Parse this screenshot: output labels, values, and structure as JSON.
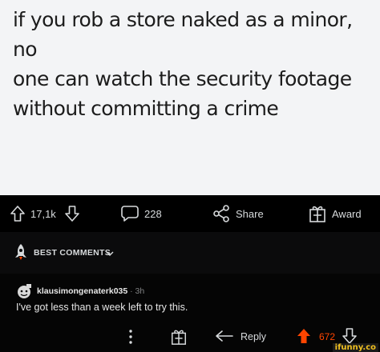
{
  "meme": {
    "lines": [
      "if you rob a store naked as a minor, no",
      "one can watch the security footage",
      "without committing a crime"
    ]
  },
  "actions": {
    "upvotes": "17,1k",
    "comments": "228",
    "share_label": "Share",
    "award_label": "Award"
  },
  "comments_header": {
    "sort_label": "BEST COMMENTS"
  },
  "comment": {
    "username": "klausimongenaterk035",
    "time": " · 3h",
    "body": "I've got less than a week left to try this.",
    "reply_label": "Reply",
    "score": "672"
  },
  "watermark": "ifunny.co",
  "colors": {
    "upvoted": "#ff4500",
    "text": "#d7dadc"
  }
}
